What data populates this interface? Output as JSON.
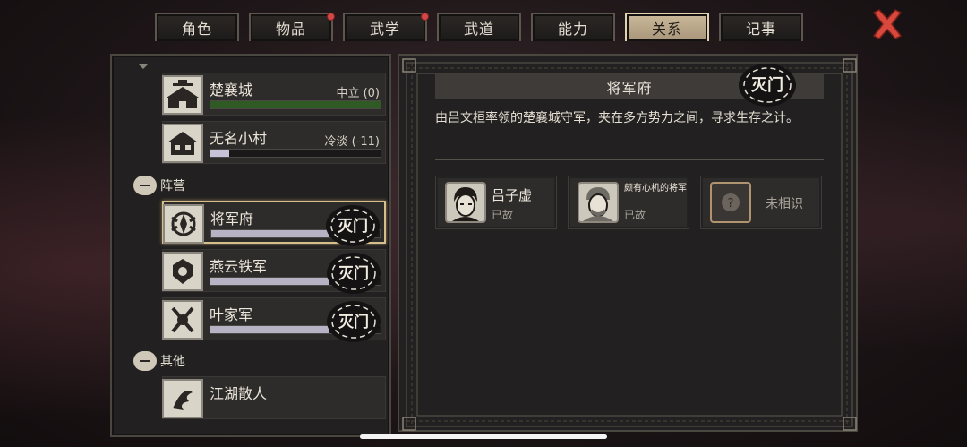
{
  "tabs": [
    {
      "label": "角色",
      "badge": false,
      "active": false
    },
    {
      "label": "物品",
      "badge": true,
      "active": false
    },
    {
      "label": "武学",
      "badge": true,
      "active": false
    },
    {
      "label": "武道",
      "badge": false,
      "active": false
    },
    {
      "label": "能力",
      "badge": false,
      "active": false
    },
    {
      "label": "关系",
      "badge": false,
      "active": true
    },
    {
      "label": "记事",
      "badge": false,
      "active": false
    }
  ],
  "sections": {
    "faction": "阵营",
    "other": "其他"
  },
  "locations": [
    {
      "name": "楚襄城",
      "status": "中立 (0)",
      "bar_fraction": 1.0,
      "bar_color": "#2f5a24",
      "icon": "city-gate-icon"
    },
    {
      "name": "无名小村",
      "status": "冷淡 (-11)",
      "bar_fraction": 0.11,
      "bar_color": "#c8c2d8",
      "icon": "village-house-icon"
    }
  ],
  "factions": [
    {
      "name": "将军府",
      "bar_fraction": 0.7,
      "bar_color": "#b7b2c4",
      "seal": "灭门",
      "selected": true,
      "icon": "general-crest-icon"
    },
    {
      "name": "燕云铁军",
      "bar_fraction": 0.7,
      "bar_color": "#b7b2c4",
      "seal": "灭门",
      "selected": false,
      "icon": "iron-army-crest-icon"
    },
    {
      "name": "叶家军",
      "bar_fraction": 0.7,
      "bar_color": "#b7b2c4",
      "seal": "灭门",
      "selected": false,
      "icon": "ye-army-crest-icon"
    }
  ],
  "others": [
    {
      "name": "江湖散人",
      "icon": "wanderer-icon"
    }
  ],
  "detail": {
    "title": "将军府",
    "seal": "灭门",
    "description": "由吕文桓率领的楚襄城守军，夹在多方势力之间，寻求生存之计。",
    "members": [
      {
        "name": "吕子虚",
        "state": "已故",
        "portrait": "young-man-portrait-icon"
      },
      {
        "name": "颇有心机的将军",
        "state": "已故",
        "portrait": "general-portrait-icon"
      },
      {
        "name": "未相识",
        "state": "",
        "portrait": "question-mark-icon"
      }
    ]
  },
  "colors": {
    "accent": "#d6bf8a",
    "active_tab": "#cbb99a",
    "badge": "#d04848",
    "close": "#d9483c"
  }
}
